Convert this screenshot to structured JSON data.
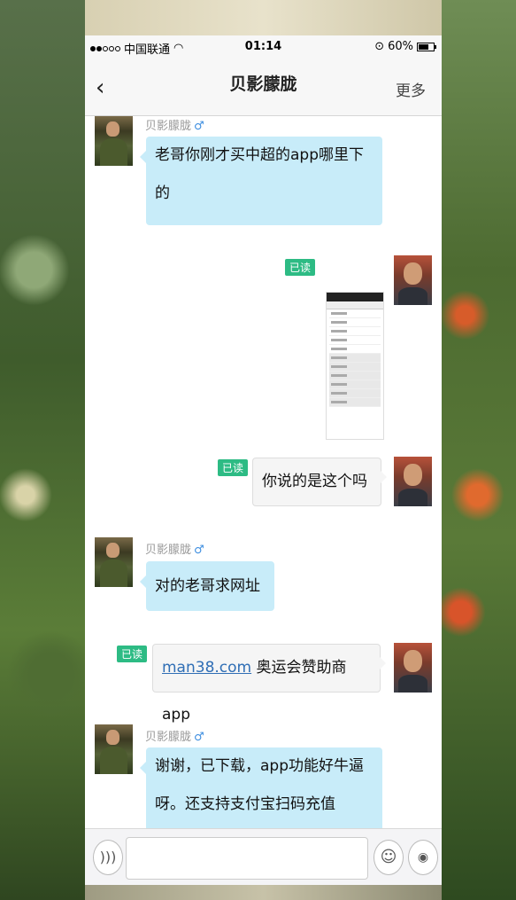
{
  "status": {
    "carrier": "中国联通",
    "time": "01:14",
    "battery": "60%"
  },
  "nav": {
    "back_icon": "‹",
    "title": "贝影朦胧",
    "more_label": "更多"
  },
  "messages": [
    {
      "side": "in",
      "name": "贝影朦胧",
      "line1": "老哥你刚才买中超的app哪里下",
      "line2": "的"
    },
    {
      "side": "out",
      "type": "image",
      "read": "已读"
    },
    {
      "side": "out",
      "text": "你说的是这个吗",
      "read": "已读"
    },
    {
      "side": "in",
      "name": "贝影朦胧",
      "text": "对的老哥求网址"
    },
    {
      "side": "out",
      "link": "man38.com",
      "text": " 奥运会赞助商app",
      "read": "已读"
    },
    {
      "side": "in",
      "name": "贝影朦胧",
      "line1": "谢谢，已下载，app功能好牛逼",
      "line2": "呀。还支持支付宝扫码充值"
    }
  ],
  "gender_icon": "♂",
  "input": {
    "voice_icon": "voice-icon",
    "emoji_icon": "emoji-icon",
    "camera_icon": "camera-icon",
    "value": ""
  }
}
